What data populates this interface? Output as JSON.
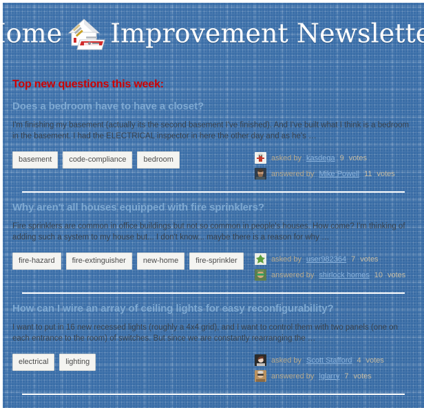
{
  "masthead": {
    "title_before": "Home",
    "title_after": "Improvement Newsletter",
    "logo_name": "home-improvement-house-toolbox-logo"
  },
  "section": {
    "heading": "Top new questions this week:",
    "heading_color": "#cc0000"
  },
  "theme": {
    "paper_blue": "#3a6ea8",
    "title_blue": "#7ea9d2",
    "link_blue": "#8cb4dd",
    "meta_tan": "#b9ab8e",
    "divider_white": "#ffffff",
    "tag_bg": "#f4f4f1"
  },
  "labels": {
    "asked_by": "asked by",
    "answered_by": "answered by",
    "votes": "votes"
  },
  "questions": [
    {
      "title": "Does a bedroom have to have a closet?",
      "excerpt": "I'm finishing my basement (actually its the second basement I've finished). And I've built what I think is a bedroom in the basement. I had the ELECTRICAL inspector in here the other day and as he's …",
      "tags": [
        "basement",
        "code-compliance",
        "bedroom"
      ],
      "asker": {
        "name": "kasdega",
        "votes": "9",
        "avatar": "kasdega-avatar"
      },
      "answerer": {
        "name": "Mike Powell",
        "votes": "11",
        "avatar": "mike-powell-avatar"
      }
    },
    {
      "title": "Why aren't all houses equipped with fire sprinklers?",
      "excerpt": "Fire sprinklers are common in office buildings but not so common in people's houses. How come? I'm thinking of adding such a system to my house but... I don't know... maybe there is a reason for why …",
      "tags": [
        "fire-hazard",
        "fire-extinguisher",
        "new-home",
        "fire-sprinkler"
      ],
      "asker": {
        "name": "user982364",
        "votes": "7",
        "avatar": "user982364-avatar"
      },
      "answerer": {
        "name": "shirlock homes",
        "votes": "10",
        "avatar": "shirlock-homes-avatar"
      }
    },
    {
      "title": "How can I wire an array of ceiling lights for easy reconfigurability?",
      "excerpt": "I want to put in 16 new recessed lights (roughly a 4x4 grid), and I want to control them with two panels (one on each entrance to the room) of switches. But since we are constantly rearranging the …",
      "tags": [
        "electrical",
        "lighting"
      ],
      "asker": {
        "name": "Scott Stafford",
        "votes": "4",
        "avatar": "scott-stafford-avatar"
      },
      "answerer": {
        "name": "lglarry",
        "votes": "7",
        "avatar": "lglarry-avatar"
      }
    }
  ]
}
